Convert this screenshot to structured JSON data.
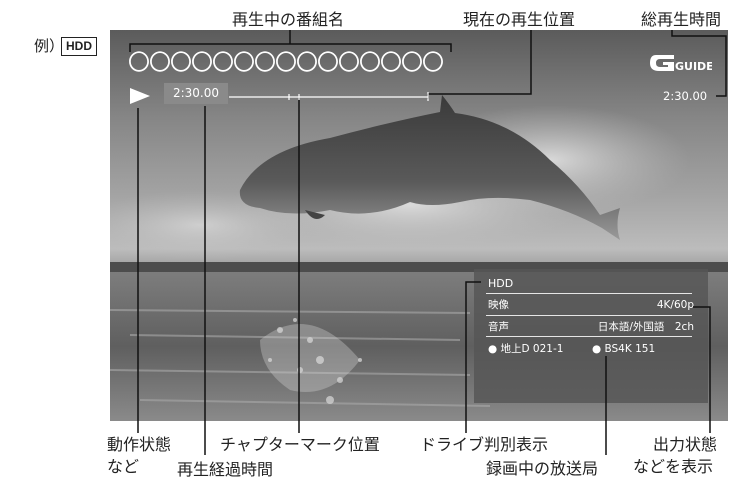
{
  "example_label": "例）",
  "example_badge": "HDD",
  "callouts": {
    "program_name": "再生中の番組名",
    "current_position": "現在の再生位置",
    "total_time": "総再生時間",
    "operation_status_1": "動作状態",
    "operation_status_2": "など",
    "elapsed_time": "再生経過時間",
    "chapter_mark": "チャプターマーク位置",
    "drive_display": "ドライブ判別表示",
    "recording_station": "録画中の放送局",
    "output_status_1": "出力状態",
    "output_status_2": "などを表示"
  },
  "screen": {
    "title_circles": "〇〇〇〇〇〇〇〇〇〇〇〇〇〇〇",
    "elapsed": "2:30.00",
    "total": "2:30.00",
    "logo_text": "GUIDE",
    "play_icon": "play-icon",
    "colors": {
      "overlay_text": "#ffffff",
      "panel": "#555555",
      "time_box": "#8a8a8a"
    }
  },
  "info_panel": {
    "drive": "HDD",
    "video_label": "映像",
    "video_value": "4K/60p",
    "audio_label": "音声",
    "audio_value": "日本語/外国語　2ch",
    "station_1": "● 地上D 021-1",
    "station_2": "● BS4K 151"
  }
}
